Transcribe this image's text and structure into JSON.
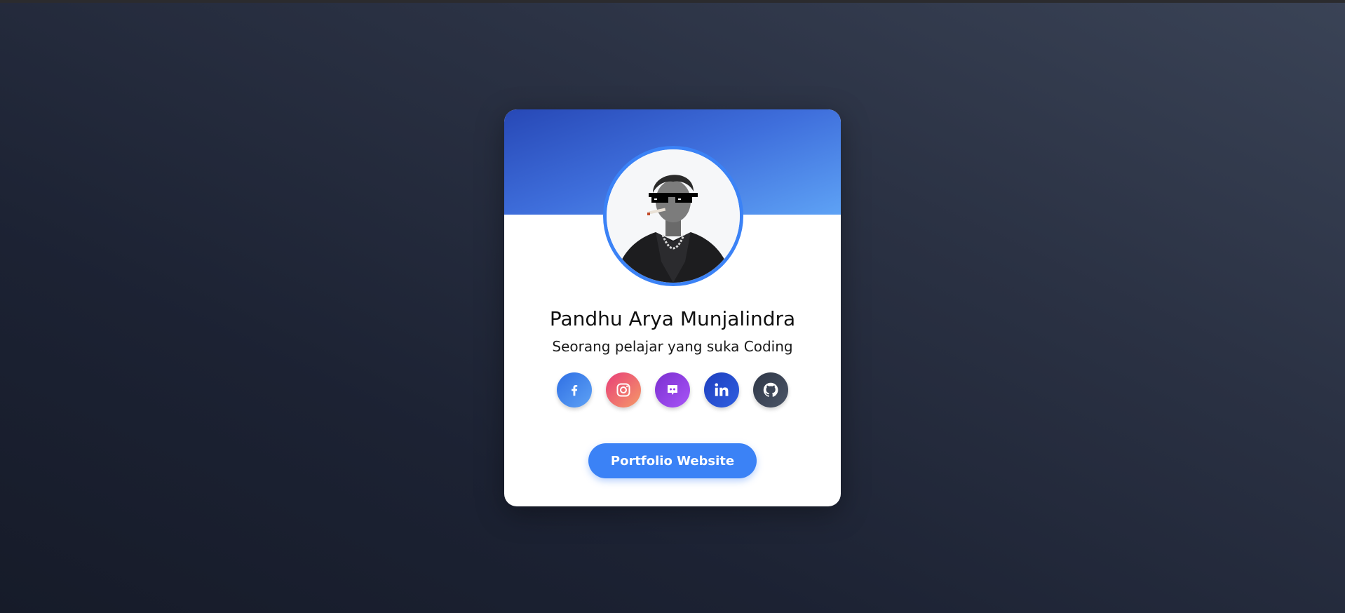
{
  "profile": {
    "name": "Pandhu Arya Munjalindra",
    "tagline": "Seorang pelajar yang suka Coding"
  },
  "avatar": {
    "alt": "profile-photo"
  },
  "socials": [
    {
      "name": "facebook",
      "icon": "facebook-icon",
      "color": "#3b82f6"
    },
    {
      "name": "instagram",
      "icon": "instagram-icon",
      "color": "#ec4899"
    },
    {
      "name": "discord",
      "icon": "discord-icon",
      "color": "#9333ea"
    },
    {
      "name": "linkedin",
      "icon": "linkedin-icon",
      "color": "#1d4ed8"
    },
    {
      "name": "github",
      "icon": "github-icon",
      "color": "#374151"
    }
  ],
  "button": {
    "label": "Portfolio Website"
  },
  "colors": {
    "accent": "#3b82f6",
    "banner_start": "#2748b6",
    "banner_end": "#5ea2f5",
    "card": "#ffffff"
  }
}
